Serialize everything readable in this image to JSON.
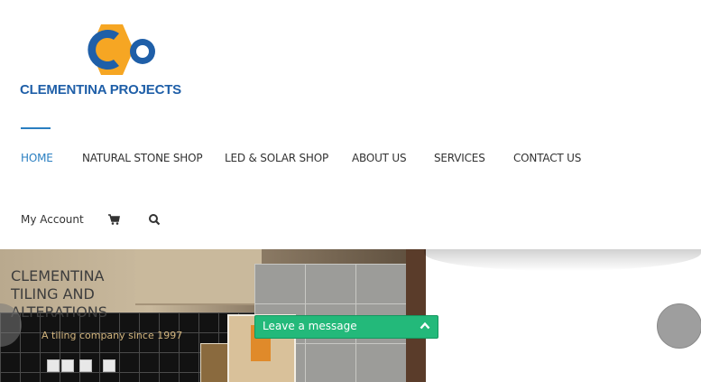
{
  "brand": {
    "logo_text": "CLEMENTINA PROJECTS",
    "colors": {
      "primary": "#1f5fa8",
      "accent": "#f6a623",
      "nav_active": "#2a7fc1"
    }
  },
  "nav": {
    "items": [
      {
        "label": "HOME",
        "active": true
      },
      {
        "label": "NATURAL STONE SHOP"
      },
      {
        "label": "LED & SOLAR SHOP"
      },
      {
        "label": "ABOUT US"
      },
      {
        "label": "SERVICES"
      },
      {
        "label": "CONTACT US"
      }
    ]
  },
  "sub_nav": {
    "account_label": "My Account",
    "cart_icon": "cart-icon",
    "search_icon": "search-icon"
  },
  "hero": {
    "title": "CLEMENTINA TILING AND ALTERATIONS",
    "tagline": "A tiling company since 1997"
  },
  "chat": {
    "label": "Leave a message",
    "toggle_icon": "chevron-up-icon",
    "color": "#23b97a"
  }
}
